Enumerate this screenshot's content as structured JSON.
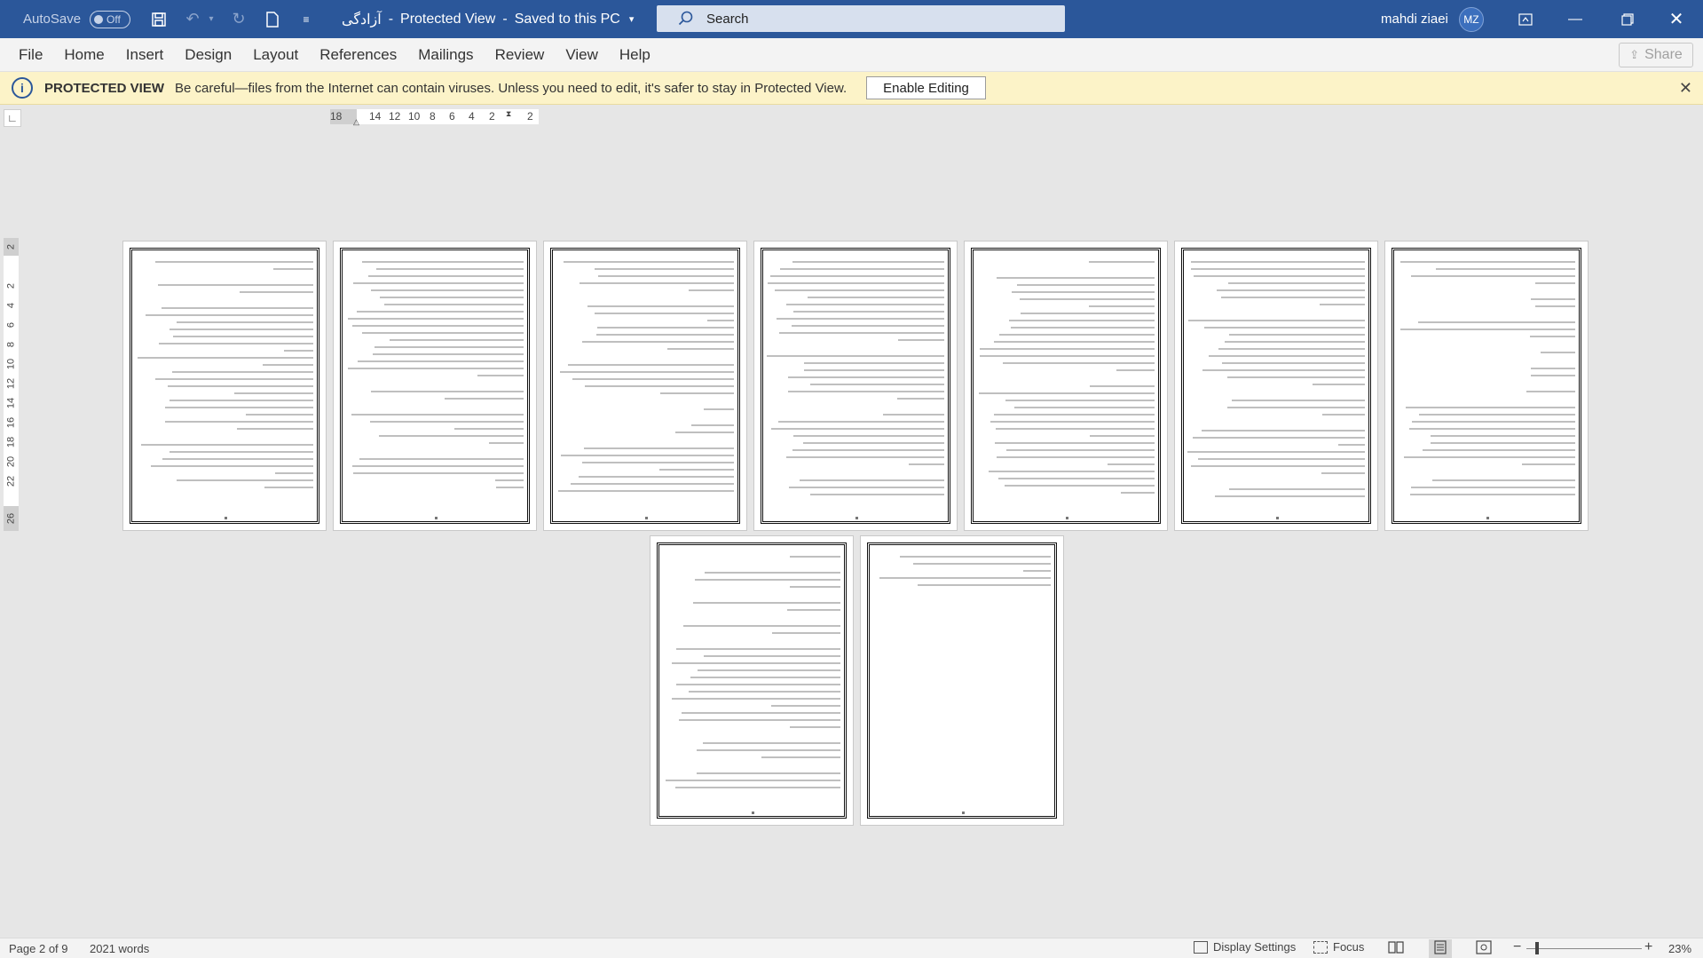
{
  "titlebar": {
    "autosave_label": "AutoSave",
    "autosave_state": "Off",
    "doc_name": "آزادگی",
    "view_mode": "Protected View",
    "save_status": "Saved to this PC",
    "search_placeholder": "Search",
    "user_name": "mahdi ziaei",
    "user_initials": "MZ"
  },
  "menu": {
    "items": [
      "File",
      "Home",
      "Insert",
      "Design",
      "Layout",
      "References",
      "Mailings",
      "Review",
      "View",
      "Help"
    ],
    "share_label": "Share"
  },
  "protected_view": {
    "title": "PROTECTED VIEW",
    "message": "Be careful—files from the Internet can contain viruses. Unless you need to edit, it's safer to stay in Protected View.",
    "button": "Enable Editing"
  },
  "ruler": {
    "horizontal_ticks": [
      "18",
      "14",
      "12",
      "10",
      "8",
      "6",
      "4",
      "2",
      "2"
    ],
    "vertical_ticks": [
      "2",
      "2",
      "4",
      "6",
      "8",
      "10",
      "12",
      "14",
      "16",
      "18",
      "20",
      "22",
      "26"
    ]
  },
  "document": {
    "page_count": 9
  },
  "status": {
    "page_info": "Page 2 of 9",
    "word_count": "2021 words",
    "display_settings": "Display Settings",
    "focus": "Focus",
    "zoom": "23%",
    "zoom_minus": "−",
    "zoom_plus": "+"
  },
  "colors": {
    "titlebar": "#2b579a",
    "protected_bar": "#fcf3c8"
  }
}
